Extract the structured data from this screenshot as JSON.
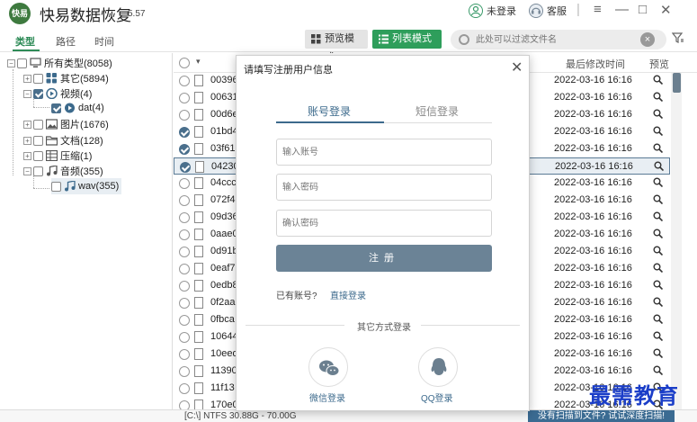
{
  "app": {
    "logo_text": "快易",
    "title": "快易数据恢复",
    "version": "5.57",
    "user_label": "未登录",
    "service_label": "客服"
  },
  "window_controls": {
    "menu": "≡",
    "minimize": "—",
    "maximize": "□",
    "close": "✕"
  },
  "tabs": [
    {
      "label": "类型",
      "active": true
    },
    {
      "label": "路径",
      "active": false
    },
    {
      "label": "时间",
      "active": false
    }
  ],
  "view_modes": {
    "preview": "预览模式",
    "list": "列表模式",
    "active": "list"
  },
  "search": {
    "placeholder": "此处可以过滤文件名"
  },
  "tree": {
    "root": "所有类型(8058)",
    "items": [
      {
        "label": "其它(5894)",
        "icon": "grid-icon",
        "checked": false
      },
      {
        "label": "视频(4)",
        "icon": "video-icon",
        "checked": true
      },
      {
        "label": "dat(4)",
        "icon": "video-icon",
        "checked": true,
        "child": true
      },
      {
        "label": "图片(1676)",
        "icon": "image-icon",
        "checked": false
      },
      {
        "label": "文档(128)",
        "icon": "folder-icon",
        "checked": false
      },
      {
        "label": "压缩(1)",
        "icon": "archive-icon",
        "checked": false
      },
      {
        "label": "音频(355)",
        "icon": "music-icon",
        "checked": false
      },
      {
        "label": "wav(355)",
        "icon": "music-icon",
        "checked": false,
        "child": true,
        "highlighted": true
      }
    ]
  },
  "table": {
    "headers": {
      "date": "最后修改时间",
      "preview": "预览"
    },
    "rows": [
      {
        "name": "00396",
        "date": "2022-03-16  16:16",
        "checked": false,
        "selected": false
      },
      {
        "name": "00631",
        "date": "2022-03-16  16:16",
        "checked": false,
        "selected": false
      },
      {
        "name": "00d6e",
        "date": "2022-03-16  16:16",
        "checked": false,
        "selected": false
      },
      {
        "name": "01bd4",
        "date": "2022-03-16  16:16",
        "checked": true,
        "selected": false
      },
      {
        "name": "03f61",
        "date": "2022-03-16  16:16",
        "checked": true,
        "selected": false
      },
      {
        "name": "04230",
        "date": "2022-03-16  16:16",
        "checked": true,
        "selected": true
      },
      {
        "name": "04ccc",
        "date": "2022-03-16  16:16",
        "checked": false,
        "selected": false
      },
      {
        "name": "072f4",
        "date": "2022-03-16  16:16",
        "checked": false,
        "selected": false
      },
      {
        "name": "09d36",
        "date": "2022-03-16  16:16",
        "checked": false,
        "selected": false
      },
      {
        "name": "0aae0",
        "date": "2022-03-16  16:16",
        "checked": false,
        "selected": false
      },
      {
        "name": "0d91b",
        "date": "2022-03-16  16:16",
        "checked": false,
        "selected": false
      },
      {
        "name": "0eaf7",
        "date": "2022-03-16  16:16",
        "checked": false,
        "selected": false
      },
      {
        "name": "0edb8",
        "date": "2022-03-16  16:16",
        "checked": false,
        "selected": false
      },
      {
        "name": "0f2aa",
        "date": "2022-03-16  16:16",
        "checked": false,
        "selected": false
      },
      {
        "name": "0fbca",
        "date": "2022-03-16  16:16",
        "checked": false,
        "selected": false
      },
      {
        "name": "10644",
        "date": "2022-03-16  16:16",
        "checked": false,
        "selected": false
      },
      {
        "name": "10eed",
        "date": "2022-03-16  16:16",
        "checked": false,
        "selected": false
      },
      {
        "name": "11390",
        "date": "2022-03-16  16:16",
        "checked": false,
        "selected": false
      },
      {
        "name": "11f13",
        "date": "2022-03-16  16:16",
        "checked": false,
        "selected": false
      },
      {
        "name": "170e0",
        "date": "2022-03-16  16:16",
        "checked": false,
        "selected": false
      }
    ]
  },
  "status": {
    "drive": "[C:\\] NTFS 30.88G - 70.00G",
    "deep_scan": "没有扫描到文件? 试试深度扫描!"
  },
  "watermark": "最需教育",
  "modal": {
    "title": "请填写注册用户信息",
    "tab_account": "账号登录",
    "tab_sms": "短信登录",
    "account_placeholder": "输入账号",
    "password_placeholder": "输入密码",
    "confirm_placeholder": "确认密码",
    "register_button": "注册",
    "have_account": "已有账号?",
    "direct_login": "直接登录",
    "other_methods": "其它方式登录",
    "wechat_login": "微信登录",
    "qq_login": "QQ登录"
  },
  "colors": {
    "accent_green": "#2e9e5b",
    "accent_blue": "#3c6a8c",
    "register_button": "#6b8396",
    "deep_scan_bg": "#3b6b92",
    "watermark": "#1b3ec8"
  }
}
